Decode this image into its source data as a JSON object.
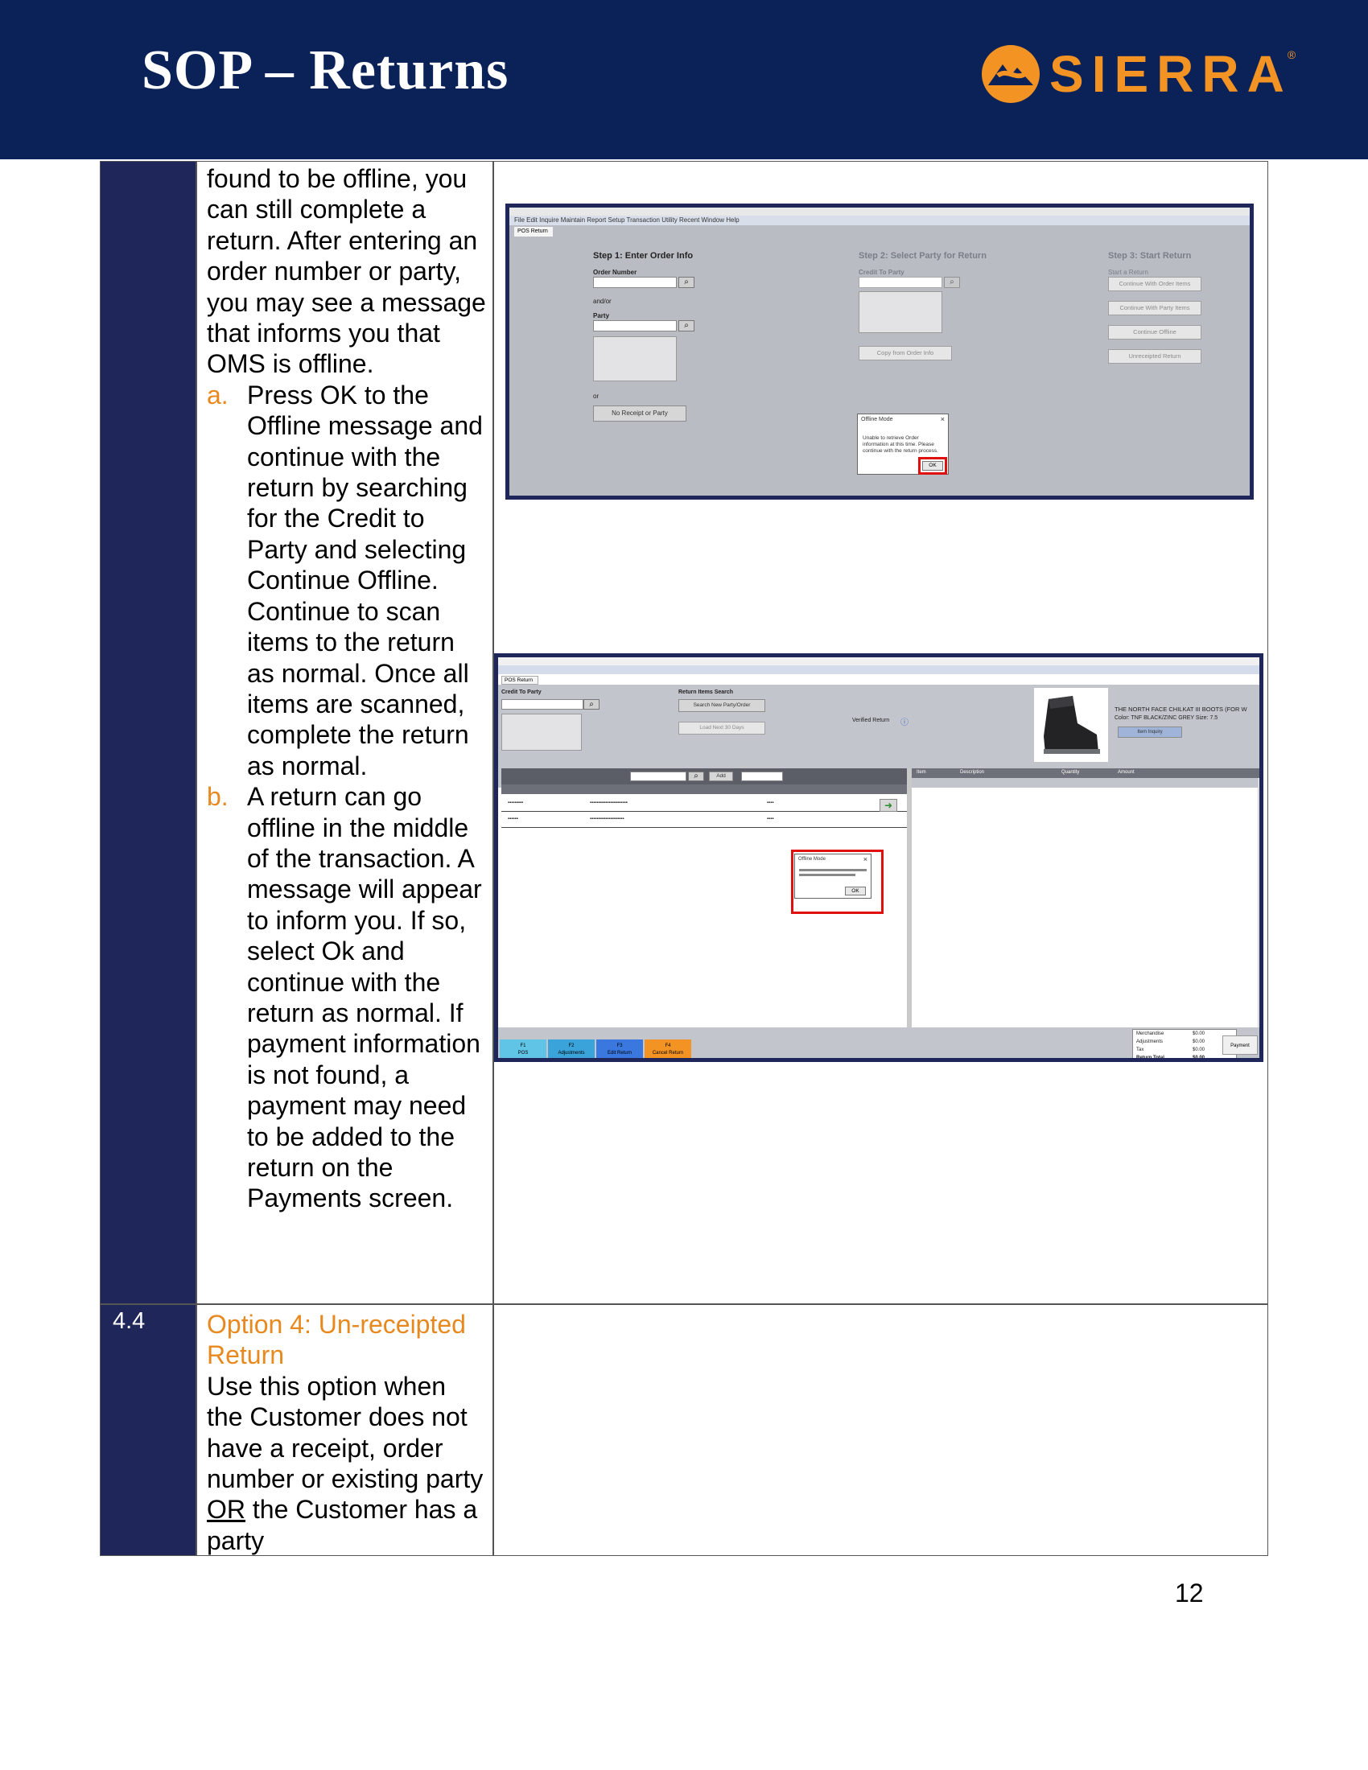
{
  "header": {
    "title": "SOP – Returns",
    "logo_text": "SIERRA",
    "logo_mark": "®",
    "logo_icon": "sierra-mountain-icon",
    "bg_color": "#0b2258",
    "accent_color": "#f39323"
  },
  "row1": {
    "intro": "found to be offline, you can still complete a return. After entering an order number or party, you may see a message that informs you that OMS is offline.",
    "items": [
      {
        "marker": "a.",
        "text": "Press OK to the Offline message and continue with the return by searching for the Credit to Party and selecting Continue Offline. Continue to scan items to the return as normal. Once all items are scanned, complete the return as normal."
      },
      {
        "marker": "b.",
        "text": "A return can go offline in the middle of the transaction. A message will appear to inform you. If so, select Ok and continue with the return as normal. If payment information is not found, a payment may need to be added to the return on the Payments screen."
      }
    ]
  },
  "row2": {
    "number": "4.4",
    "heading": "Option 4: Un-receipted Return",
    "text_before": "Use this option when the Customer does not have a receipt, order number or existing party ",
    "underlined": "OR",
    "text_after": " the Customer has a party"
  },
  "screenshot1": {
    "menu": "File  Edit  Inquire  Maintain  Report  Setup  Transaction  Utility  Recent  Window  Help",
    "tab": "POS Return",
    "step1": "Step 1: Enter Order Info",
    "order_number_label": "Order Number",
    "andor": "and/or",
    "party_label": "Party",
    "or": "or",
    "no_receipt_button": "No Receipt or Party",
    "step2": "Step 2: Select Party for Return",
    "credit_to_party": "Credit To Party",
    "copy_button": "Copy from Order Info",
    "step3": "Step 3: Start Return",
    "start_a_return": "Start a Return",
    "btn_continue_order": "Continue With Order Items",
    "btn_continue_party": "Continue With Party Items",
    "btn_continue_offline": "Continue Offline",
    "btn_unreceipted": "Unreceipted Return",
    "dialog_title": "Offline Mode",
    "dialog_message": "Unable to retrieve Order information at this time. Please continue with the return process.",
    "dialog_ok": "OK"
  },
  "screenshot2": {
    "tab": "POS Return",
    "credit_to_party": "Credit To Party",
    "return_items_search": "Return Items Search",
    "search_new_button": "Search New Party/Order",
    "load_next_button": "Load Next 30 Days",
    "verified_return": "Verified Return",
    "product_name": "THE NORTH FACE CHILKAT III BOOTS (FOR W",
    "product_color_label": "Color:",
    "product_color": "TNF BLACK/ZINC GREY",
    "product_size_label": "Size:",
    "product_size": "7.5",
    "item_inquiry_button": "Item Inquiry",
    "add_button": "Add",
    "right_cols": [
      "Item",
      "Description",
      "Quantity",
      "Amount"
    ],
    "dialog_title": "Offline Mode",
    "dialog_ok": "OK",
    "fkeys": [
      {
        "key": "F1",
        "label": "POS"
      },
      {
        "key": "F2",
        "label": "Adjustments"
      },
      {
        "key": "F3",
        "label": "Edit Return"
      },
      {
        "key": "F4",
        "label": "Cancel Return"
      }
    ],
    "totals": [
      {
        "label": "Merchandise",
        "value": "$0.00"
      },
      {
        "label": "Adjustments",
        "value": "$0.00"
      },
      {
        "label": "Tax",
        "value": "$0.00"
      },
      {
        "label": "Return Total",
        "value": "$0.00"
      }
    ],
    "payment_button": "Payment"
  },
  "page_number": "12"
}
